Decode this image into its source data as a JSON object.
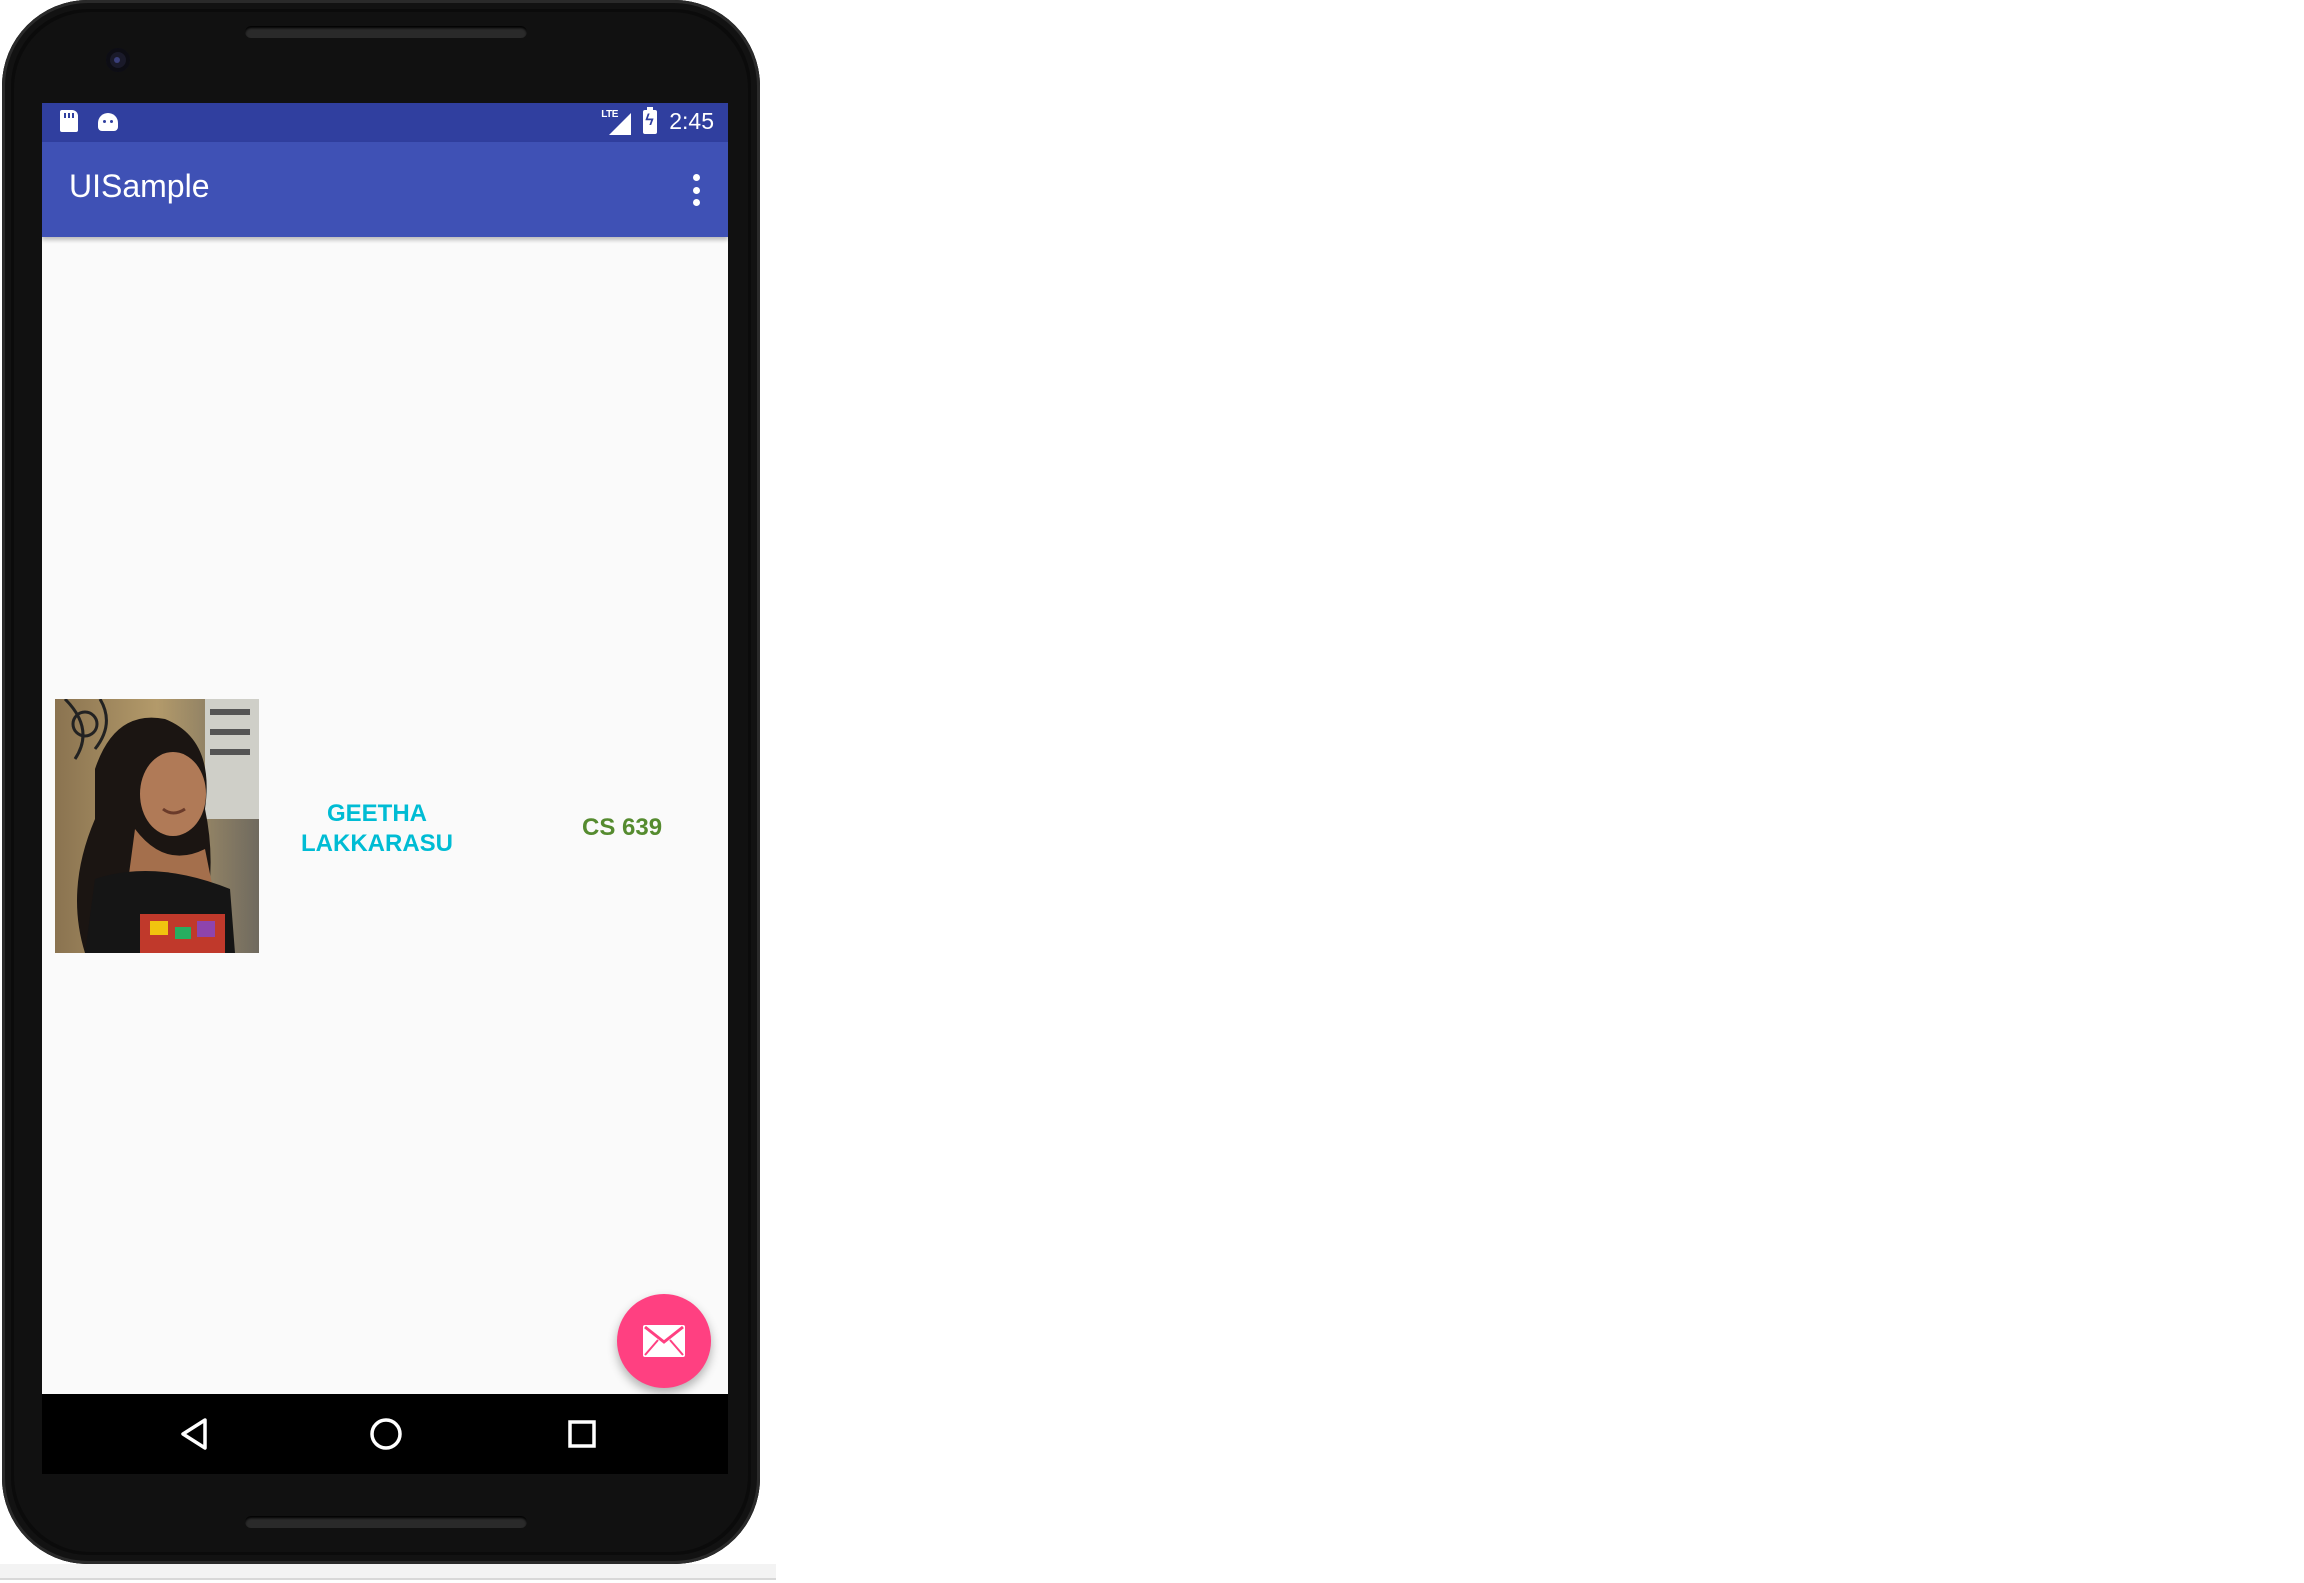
{
  "status_bar": {
    "time": "2:45",
    "network_label": "LTE",
    "icons": [
      "sd-card-icon",
      "android-icon",
      "lte-signal-icon",
      "battery-charging-icon"
    ]
  },
  "app_bar": {
    "title": "UISample",
    "overflow_icon": "more-vert-icon"
  },
  "content": {
    "photo_icon": "profile-photo",
    "name": "GEETHA\nLAKKARASU",
    "course": "CS 639",
    "name_color": "#00bcd4",
    "course_color": "#558b2f"
  },
  "fab": {
    "icon": "email-icon",
    "color": "#ff4081"
  },
  "nav_bar": {
    "icons": [
      "back-icon",
      "home-icon",
      "recents-icon"
    ]
  },
  "colors": {
    "primary": "#3f51b5",
    "primary_dark": "#303f9f",
    "accent": "#ff4081",
    "background": "#fafafa"
  }
}
